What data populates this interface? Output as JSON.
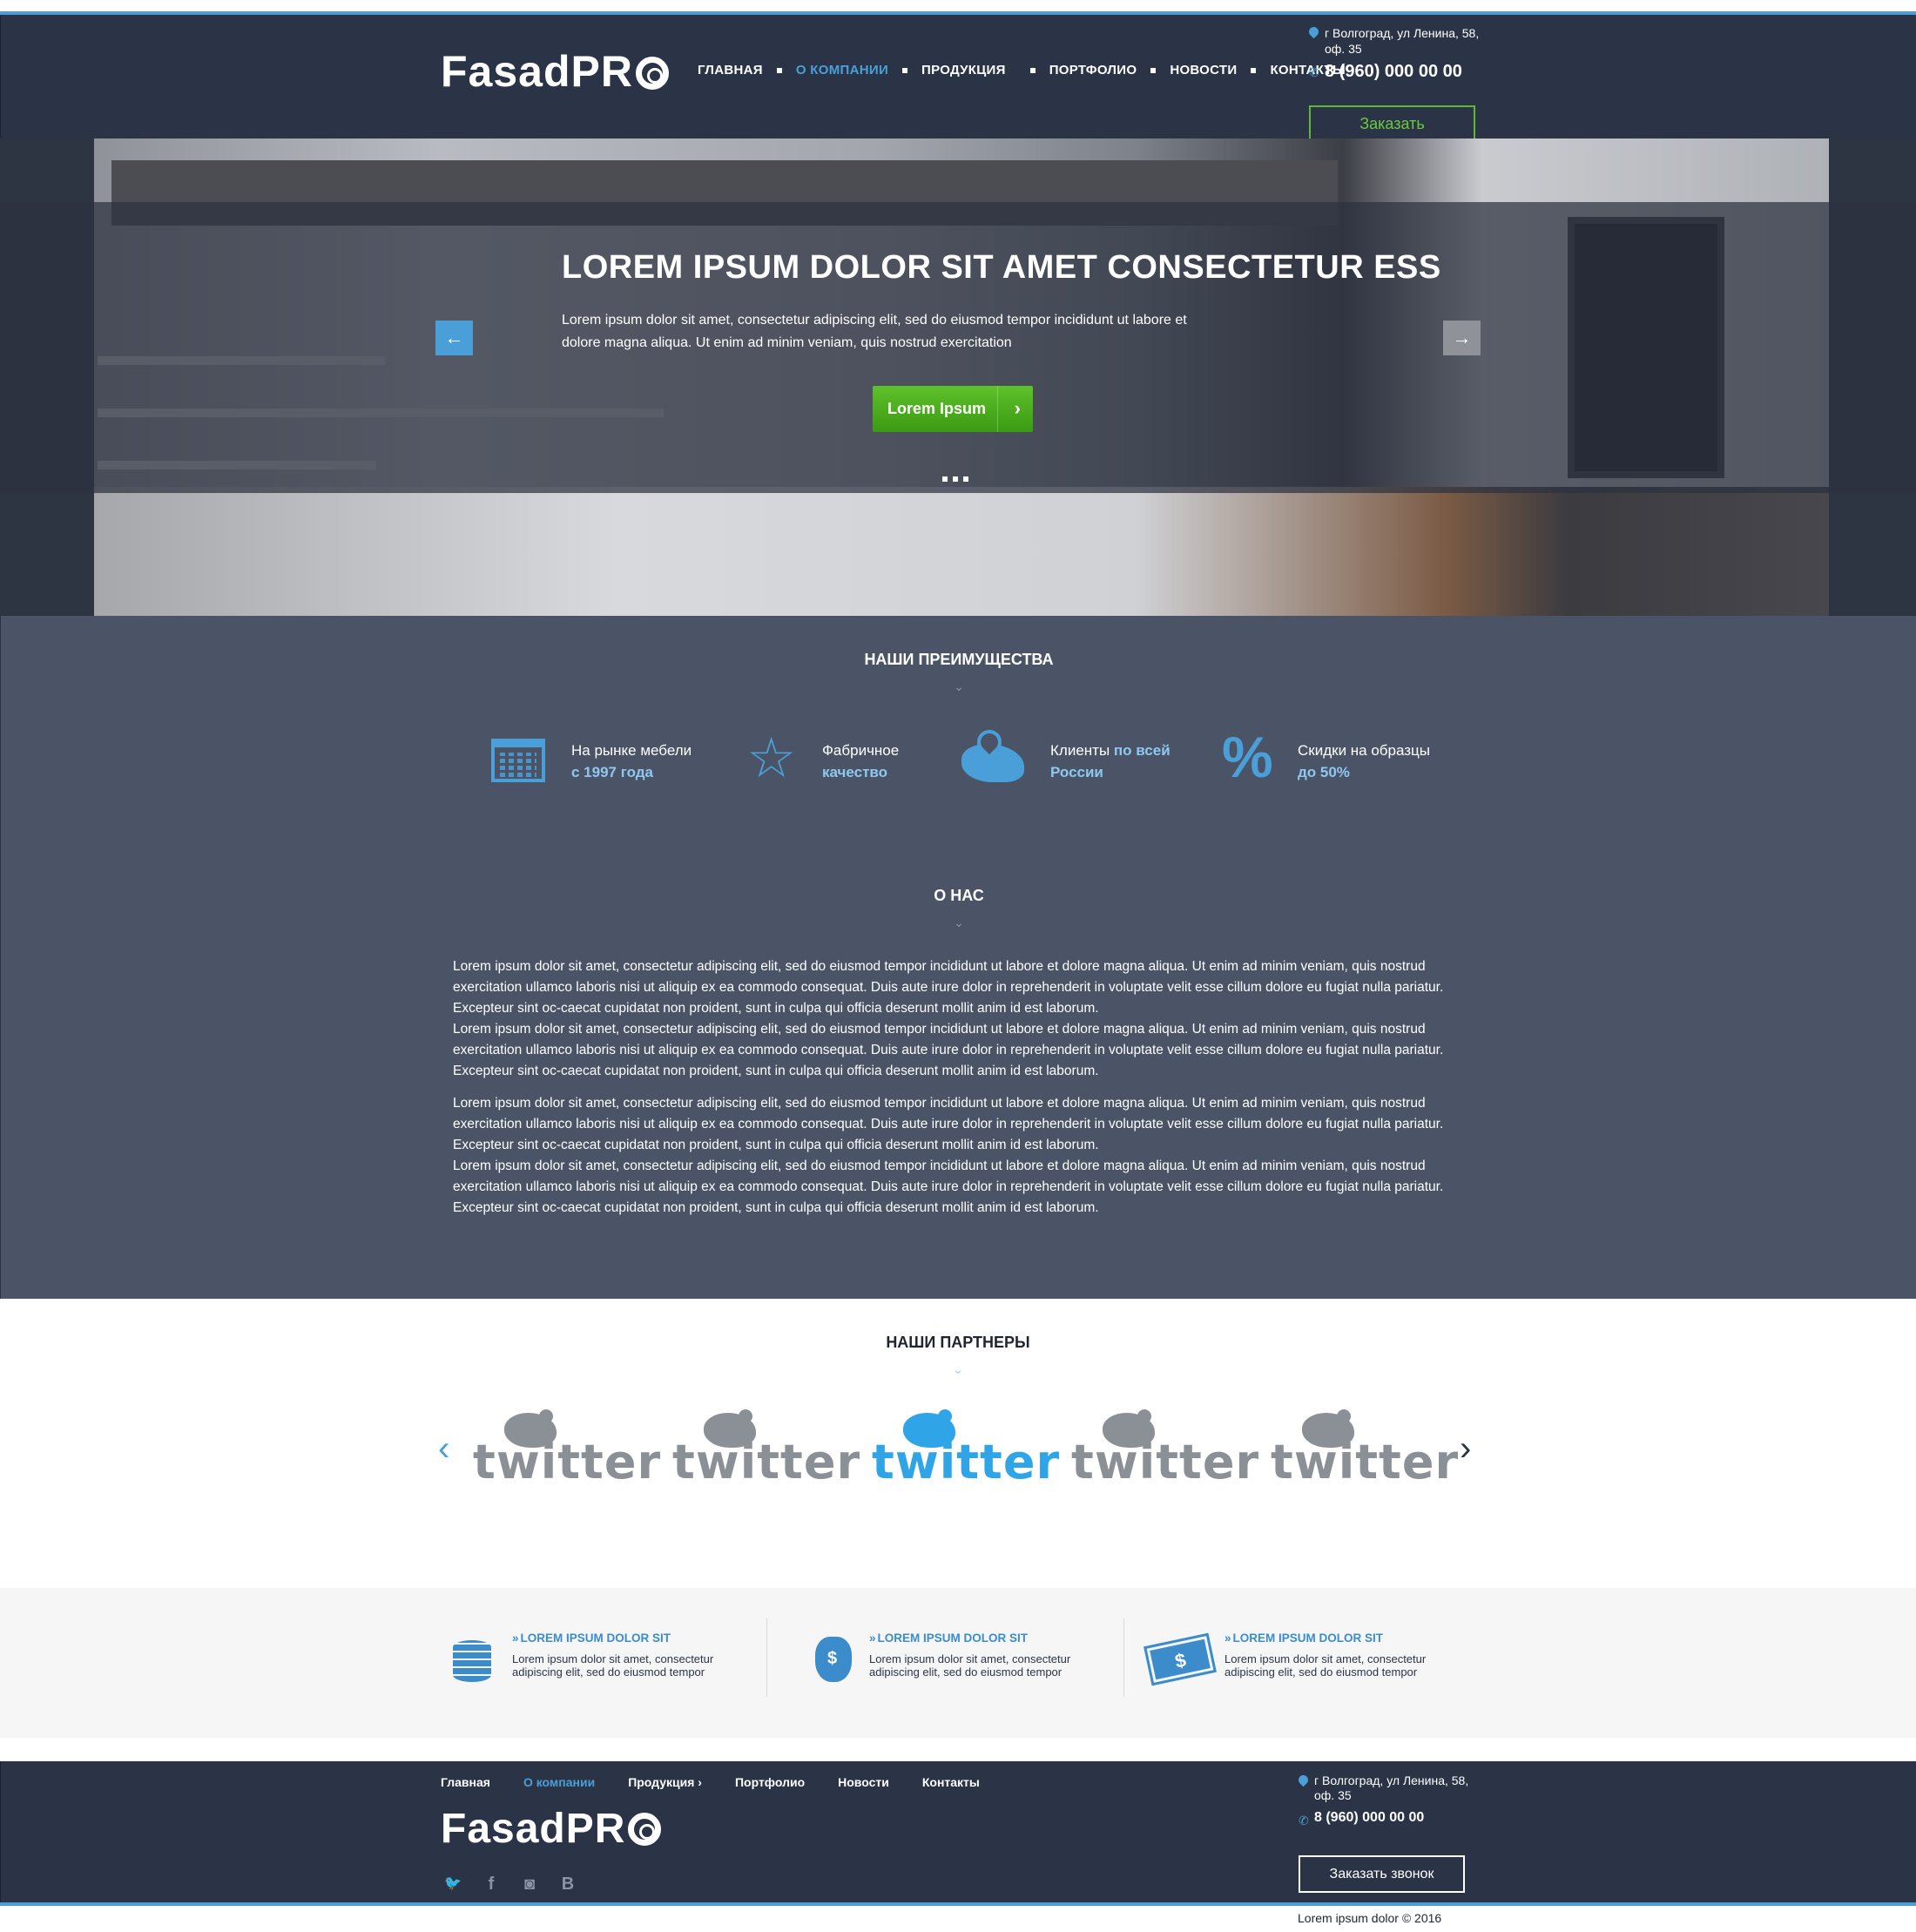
{
  "header": {
    "logo": "FasadPR",
    "nav": [
      {
        "label": "ГЛАВНАЯ",
        "active": false
      },
      {
        "label": "О КОМПАНИИ",
        "active": true
      },
      {
        "label": "ПРОДУКЦИЯ",
        "active": false
      },
      {
        "label": "ПОРТФОЛИО",
        "active": false
      },
      {
        "label": "НОВОСТИ",
        "active": false
      },
      {
        "label": "КОНТАКТЫ",
        "active": false
      }
    ],
    "address": "г Волгоград, ул Ленина, 58, оф. 35",
    "phone": "8 (960) 000 00 00",
    "order_button": "Заказать"
  },
  "hero": {
    "title": "LOREM IPSUM DOLOR SIT AMET CONSECTETUR ESS",
    "text": "Lorem ipsum dolor sit amet, consectetur adipiscing elit, sed do eiusmod tempor incididunt ut labore et dolore magna aliqua. Ut enim ad minim veniam, quis nostrud exercitation",
    "button": "Lorem Ipsum",
    "prev_icon": "arrow-left-icon",
    "next_icon": "arrow-right-icon",
    "slide_count": 3
  },
  "advantages": {
    "title": "НАШИ ПРЕИМУЩЕСТВА",
    "items": [
      {
        "icon": "calendar-icon",
        "line1": "На рынке мебели",
        "line2": "с 1997 года"
      },
      {
        "icon": "star-icon",
        "line1": "Фабричное",
        "line2": "качество"
      },
      {
        "icon": "russia-map-icon",
        "line1": "Клиенты",
        "line1_accent": "по всей",
        "line2": "России"
      },
      {
        "icon": "percent-icon",
        "line1": "Скидки на образцы",
        "line2": "до 50%"
      }
    ]
  },
  "about": {
    "title": "О НАС",
    "paragraphs": [
      "Lorem ipsum dolor sit amet, consectetur adipiscing elit, sed do eiusmod tempor incididunt ut labore et dolore magna aliqua. Ut enim ad minim veniam, quis nostrud exercitation ullamco laboris nisi ut aliquip ex ea commodo consequat. Duis aute irure dolor in reprehenderit in voluptate velit esse cillum dolore eu fugiat nulla pariatur. Excepteur sint oc-caecat cupidatat non proident, sunt in culpa qui officia deserunt mollit anim id est laborum.",
      "Lorem ipsum dolor sit amet, consectetur adipiscing elit, sed do eiusmod tempor incididunt ut labore et dolore magna aliqua. Ut enim ad minim veniam, quis nostrud exercitation ullamco laboris nisi ut aliquip ex ea commodo consequat. Duis aute irure dolor in reprehenderit in voluptate velit esse cillum dolore eu fugiat nulla pariatur. Excepteur sint oc-caecat cupidatat non proident, sunt in culpa qui officia deserunt mollit anim id est laborum.",
      "Lorem ipsum dolor sit amet, consectetur adipiscing elit, sed do eiusmod tempor incididunt ut labore et dolore magna aliqua. Ut enim ad minim veniam, quis nostrud exercitation ullamco laboris nisi ut aliquip ex ea commodo consequat. Duis aute irure dolor in reprehenderit in voluptate velit esse cillum dolore eu fugiat nulla pariatur. Excepteur sint oc-caecat cupidatat non proident, sunt in culpa qui officia deserunt mollit anim id est laborum.",
      "Lorem ipsum dolor sit amet, consectetur adipiscing elit, sed do eiusmod tempor incididunt ut labore et dolore magna aliqua. Ut enim ad minim veniam, quis nostrud exercitation ullamco laboris nisi ut aliquip ex ea commodo consequat. Duis aute irure dolor in reprehenderit in voluptate velit esse cillum dolore eu fugiat nulla pariatur. Excepteur sint oc-caecat cupidatat non proident, sunt in culpa qui officia deserunt mollit anim id est laborum."
    ]
  },
  "partners": {
    "title": "НАШИ ПАРТНЕРЫ",
    "logos": [
      {
        "word": "twitter",
        "highlighted": false
      },
      {
        "word": "twitter",
        "highlighted": false
      },
      {
        "word": "twitter",
        "highlighted": true
      },
      {
        "word": "twitter",
        "highlighted": false
      },
      {
        "word": "twitter",
        "highlighted": false
      }
    ]
  },
  "features": [
    {
      "icon": "coins-icon",
      "title": "LOREM IPSUM DOLOR SIT",
      "text": "Lorem ipsum dolor sit amet, consectetur adipiscing elit, sed do eiusmod tempor"
    },
    {
      "icon": "money-bag-icon",
      "title": "LOREM IPSUM DOLOR SIT",
      "text": "Lorem ipsum dolor sit amet, consectetur adipiscing elit, sed do eiusmod tempor"
    },
    {
      "icon": "banknotes-icon",
      "title": "LOREM IPSUM DOLOR SIT",
      "text": "Lorem ipsum dolor sit amet, consectetur adipiscing elit, sed do eiusmod tempor"
    }
  ],
  "footer": {
    "nav": [
      {
        "label": "Главная",
        "active": false
      },
      {
        "label": "О компании",
        "active": true
      },
      {
        "label": "Продукция",
        "active": false
      },
      {
        "label": "Портфолио",
        "active": false
      },
      {
        "label": "Новости",
        "active": false
      },
      {
        "label": "Контакты",
        "active": false
      }
    ],
    "logo": "FasadPR",
    "socials": [
      {
        "icon": "twitter-icon",
        "glyph": "🐦"
      },
      {
        "icon": "facebook-icon",
        "glyph": "f"
      },
      {
        "icon": "instagram-icon",
        "glyph": "◙"
      },
      {
        "icon": "vk-icon",
        "glyph": "B"
      }
    ],
    "address": "г Волгоград, ул Ленина, 58, оф. 35",
    "phone": "8 (960) 000 00 00",
    "call_button": "Заказать звонок",
    "copyright": "Lorem ipsum dolor © 2016"
  },
  "colors": {
    "header_bg": "#2a3446",
    "section_bg": "#4a5466",
    "accent_blue": "#4a9fd8",
    "accent_green": "#5cb836"
  }
}
